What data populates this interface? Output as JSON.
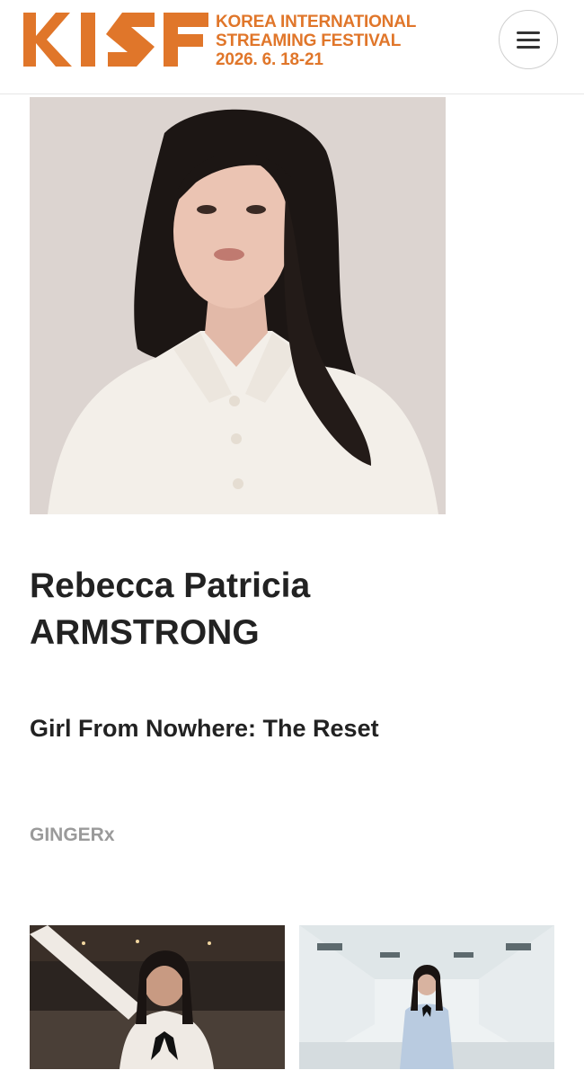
{
  "header": {
    "logo_alt": "KISF",
    "festival_line1": "KOREA INTERNATIONAL",
    "festival_line2": "STREAMING FESTIVAL",
    "festival_dates": "2026. 6. 18-21",
    "brand_color": "#e0762a",
    "menu_icon": "hamburger-icon"
  },
  "profile": {
    "name": "Rebecca Patricia ARMSTRONG",
    "work_title": "Girl From Nowhere: The Reset",
    "company": "GINGERx"
  }
}
